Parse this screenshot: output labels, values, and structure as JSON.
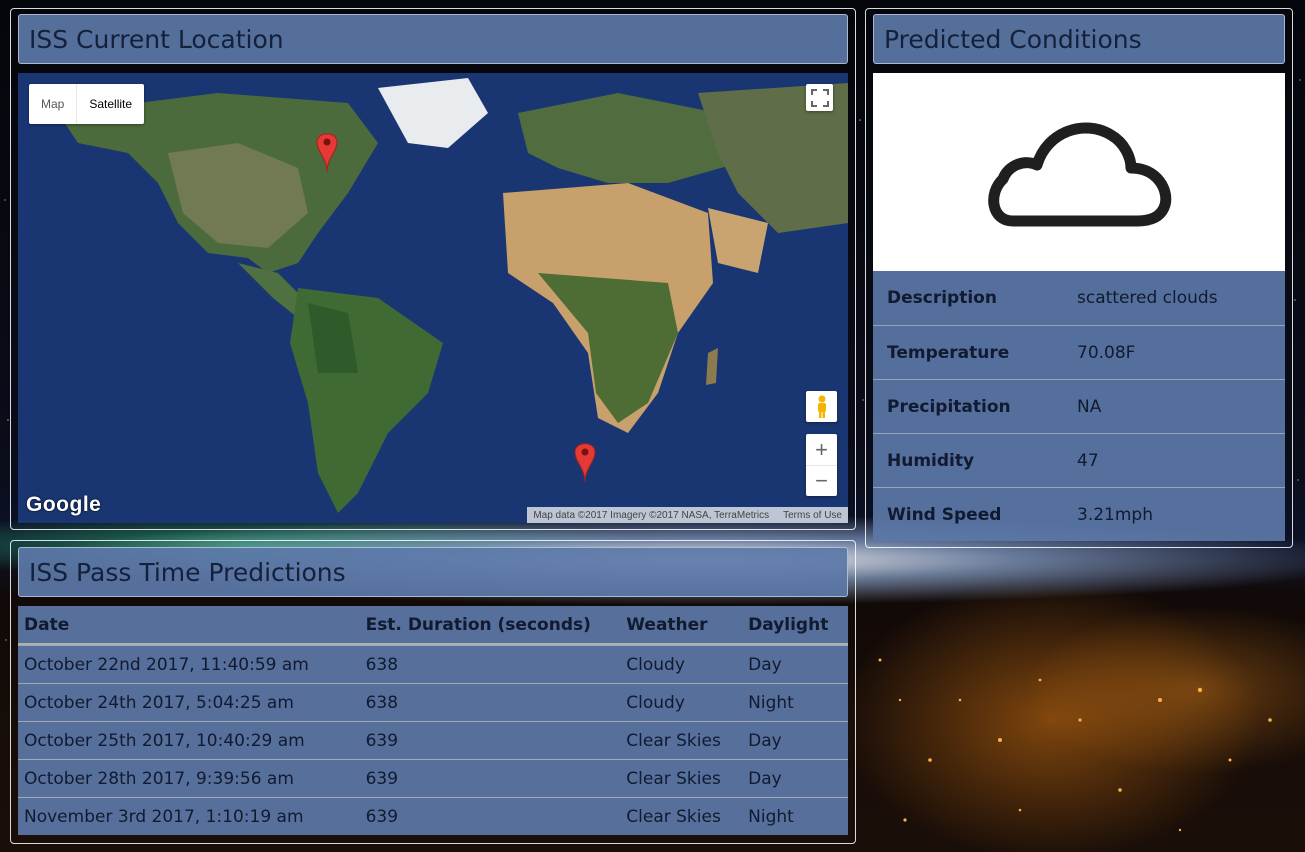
{
  "location_panel": {
    "title": "ISS Current Location"
  },
  "map": {
    "type_buttons": {
      "map": "Map",
      "satellite": "Satellite"
    },
    "selected_type": "Satellite",
    "zoom_in": "+",
    "zoom_out": "−",
    "logo": "Google",
    "attribution": "Map data ©2017 Imagery ©2017 NASA, TerraMetrics",
    "terms": "Terms of Use"
  },
  "conditions_panel": {
    "title": "Predicted Conditions",
    "icon": "cloud-icon",
    "rows": [
      {
        "label": "Description",
        "value": "scattered clouds"
      },
      {
        "label": "Temperature",
        "value": "70.08F"
      },
      {
        "label": "Precipitation",
        "value": "NA"
      },
      {
        "label": "Humidity",
        "value": "47"
      },
      {
        "label": "Wind Speed",
        "value": "3.21mph"
      }
    ]
  },
  "pass_panel": {
    "title": "ISS Pass Time Predictions",
    "headers": [
      "Date",
      "Est. Duration (seconds)",
      "Weather",
      "Daylight"
    ],
    "rows": [
      [
        "October 22nd 2017, 11:40:59 am",
        "638",
        "Cloudy",
        "Day"
      ],
      [
        "October 24th 2017, 5:04:25 am",
        "638",
        "Cloudy",
        "Night"
      ],
      [
        "October 25th 2017, 10:40:29 am",
        "639",
        "Clear Skies",
        "Day"
      ],
      [
        "October 28th 2017, 9:39:56 am",
        "639",
        "Clear Skies",
        "Day"
      ],
      [
        "November 3rd 2017, 1:10:19 am",
        "639",
        "Clear Skies",
        "Night"
      ]
    ]
  },
  "colors": {
    "panel_fill": "#5c78a8",
    "marker": "#e53935"
  }
}
